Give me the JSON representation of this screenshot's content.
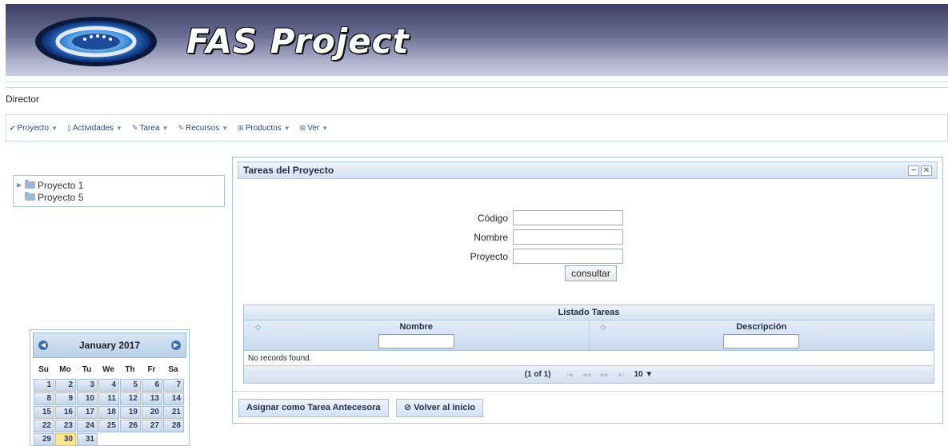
{
  "banner": {
    "title": "FAS Project"
  },
  "role": "Director",
  "menubar": {
    "items": [
      {
        "label": "Proyecto",
        "icon": "check-icon"
      },
      {
        "label": "Actividades",
        "icon": "document-icon"
      },
      {
        "label": "Tarea",
        "icon": "pencil-icon"
      },
      {
        "label": "Recursos",
        "icon": "pencil-icon"
      },
      {
        "label": "Productos",
        "icon": "grid-icon"
      },
      {
        "label": "Ver",
        "icon": "grid-icon"
      }
    ]
  },
  "tree": {
    "nodes": [
      {
        "label": "Proyecto 1",
        "expandable": true
      },
      {
        "label": "Proyecto 5",
        "expandable": false
      }
    ]
  },
  "calendar": {
    "title": "January 2017",
    "dows": [
      "Su",
      "Mo",
      "Tu",
      "We",
      "Th",
      "Fr",
      "Sa"
    ],
    "weeks": [
      [
        "1",
        "2",
        "3",
        "4",
        "5",
        "6",
        "7"
      ],
      [
        "8",
        "9",
        "10",
        "11",
        "12",
        "13",
        "14"
      ],
      [
        "15",
        "16",
        "17",
        "18",
        "19",
        "20",
        "21"
      ],
      [
        "22",
        "23",
        "24",
        "25",
        "26",
        "27",
        "28"
      ],
      [
        "29",
        "30",
        "31",
        "",
        "",
        "",
        ""
      ]
    ],
    "today": "30"
  },
  "panel": {
    "title": "Tareas del Proyecto",
    "form": {
      "codigo_label": "Código",
      "nombre_label": "Nombre",
      "proyecto_label": "Proyecto",
      "codigo_value": "",
      "nombre_value": "",
      "proyecto_value": "",
      "submit_label": "consultar"
    },
    "table": {
      "caption": "Listado Tareas",
      "columns": [
        "Nombre",
        "Descripción"
      ],
      "empty_message": "No records found.",
      "pager_report": "(1 of 1)",
      "rows_per_page": "10"
    },
    "actions": {
      "assign_label": "Asignar como Tarea Antecesora",
      "back_label": "Volver al inicio"
    }
  }
}
